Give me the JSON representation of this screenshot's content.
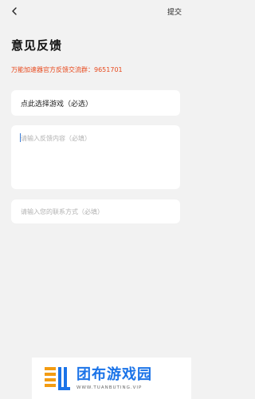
{
  "header": {
    "back_icon": "chevron-left-icon",
    "submit_label": "提交"
  },
  "page": {
    "title": "意见反馈",
    "group_info": "万能加速器官方反馈交流群：9651701"
  },
  "form": {
    "game_select_label": "点此选择游戏（必选）",
    "feedback_placeholder": "请输入反馈内容（必填）",
    "contact_placeholder": "请输入您的联系方式（必填）"
  },
  "watermark": {
    "title": "团布游戏园",
    "url": "WWW.TUANBUTING.VIP",
    "colors": {
      "blue": "#1a73e8",
      "orange": "#f39c12"
    }
  },
  "colors": {
    "accent": "#e8491d",
    "background": "#f2f2f2",
    "card": "#ffffff"
  }
}
